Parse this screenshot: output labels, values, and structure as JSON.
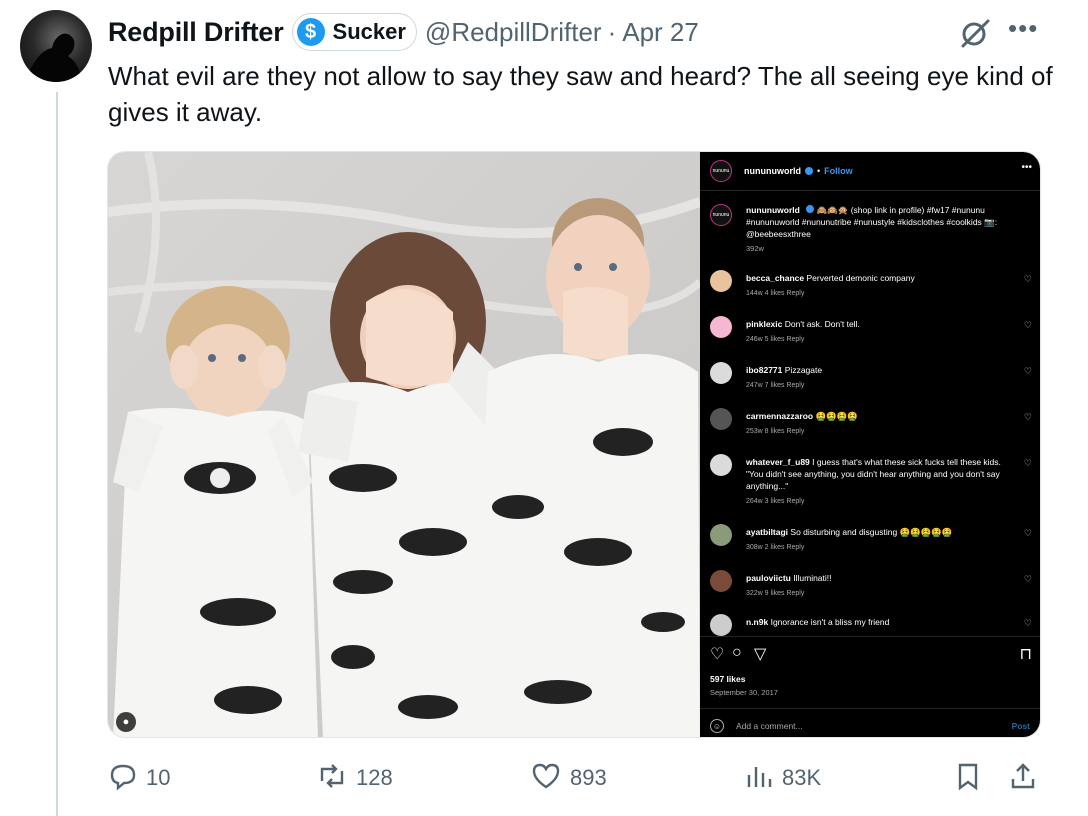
{
  "author": {
    "display_name": "Redpill Drifter",
    "badge_label": "Sucker",
    "badge_icon": "dollar-sign-icon",
    "handle": "@RedpillDrifter",
    "separator": "·",
    "date": "Apr 27"
  },
  "tweet": {
    "text": "What evil are they not allow to say they saw and heard? The all seeing eye kind of gives it away."
  },
  "instagram": {
    "header_logo": "nununu",
    "account": "nununuworld",
    "follow_sep": "•",
    "follow": "Follow",
    "caption_user": "nununuworld",
    "caption_text": "🙈🙉🙊 (shop link in profile) #fw17 #nununu #nununuworld #nununutribe #nunustyle #kidsclothes #coolkids 📷: @beebeesxthree",
    "caption_age": "392w",
    "comments": [
      {
        "user": "becca_chance",
        "text": "Perverted demonic company",
        "meta": "144w   4 likes   Reply",
        "avatar_color": "#e8c39e"
      },
      {
        "user": "pinklexic",
        "text": "Don't ask. Don't tell.",
        "meta": "246w   5 likes   Reply",
        "avatar_color": "#f7b7d2"
      },
      {
        "user": "ibo82771",
        "text": "Pizzagate",
        "meta": "247w   7 likes   Reply",
        "avatar_color": "#dbdbdb"
      },
      {
        "user": "carmennazzaroo",
        "text": "🤮🤮🤮🤮",
        "meta": "253w   8 likes   Reply",
        "avatar_color": "#555555"
      },
      {
        "user": "whatever_f_u89",
        "text": "I guess that's what these sick fucks tell these kids. \"You didn't see anything, you didn't hear anything and you don't say anything...\"",
        "meta": "264w   3 likes   Reply",
        "avatar_color": "#dbdbdb"
      },
      {
        "user": "ayatbiltagi",
        "text": "So disturbing and disgusting 🤮🤮🤮🤮🤮",
        "meta": "308w   2 likes   Reply",
        "avatar_color": "#8a9a7a"
      },
      {
        "user": "pauloviictu",
        "text": "Illuminati!!",
        "meta": "322w   9 likes   Reply",
        "avatar_color": "#7a4a3a"
      },
      {
        "user": "n.n9k",
        "text": "Ignorance isn't a bliss my friend",
        "meta": "",
        "avatar_color": "#cccccc"
      }
    ],
    "likes": "597 likes",
    "date": "September 30, 2017",
    "add_comment_placeholder": "Add a comment...",
    "post_label": "Post"
  },
  "actions": {
    "replies": "10",
    "reposts": "128",
    "likes": "893",
    "views": "83K"
  }
}
